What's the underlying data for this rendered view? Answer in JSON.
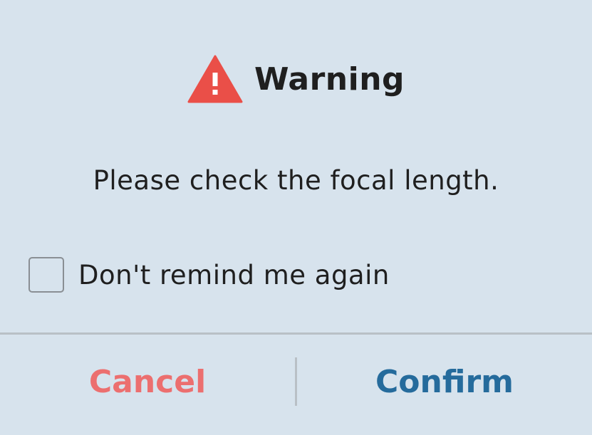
{
  "dialog": {
    "title": "Warning",
    "icon": "warning-triangle-icon",
    "message": "Please check the focal length.",
    "checkbox": {
      "label": "Don't remind me again",
      "checked": false
    },
    "buttons": {
      "cancel": "Cancel",
      "confirm": "Confirm"
    }
  },
  "colors": {
    "background": "#d7e3ed",
    "warning_icon": "#ea4f48",
    "cancel": "#ec6f6f",
    "confirm": "#256b9c",
    "divider": "#b9c0c6",
    "text": "#1f1f1f"
  }
}
